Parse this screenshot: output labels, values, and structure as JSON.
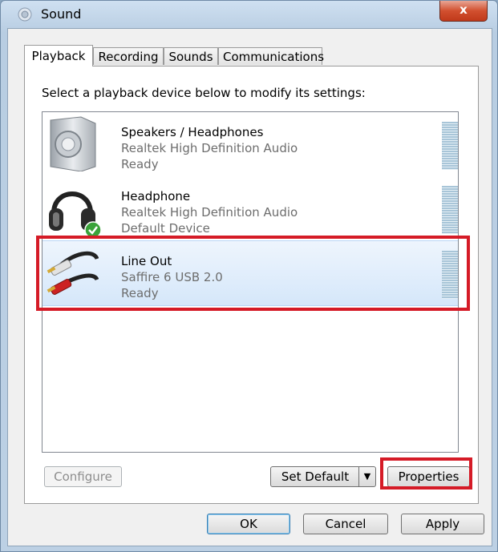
{
  "window": {
    "title": "Sound",
    "close_label": "x"
  },
  "tabs": [
    {
      "label": "Playback",
      "active": true
    },
    {
      "label": "Recording",
      "active": false
    },
    {
      "label": "Sounds",
      "active": false
    },
    {
      "label": "Communications",
      "active": false
    }
  ],
  "instruction": "Select a playback device below to modify its settings:",
  "devices": [
    {
      "name": "Speakers / Headphones",
      "driver": "Realtek High Definition Audio",
      "status": "Ready",
      "icon": "speaker-icon",
      "selected": false
    },
    {
      "name": "Headphone",
      "driver": "Realtek High Definition Audio",
      "status": "Default Device",
      "icon": "headphone-icon",
      "selected": false,
      "default": true
    },
    {
      "name": "Line Out",
      "driver": "Saffire 6 USB 2.0",
      "status": "Ready",
      "icon": "rca-cable-icon",
      "selected": true
    }
  ],
  "buttons": {
    "configure": "Configure",
    "set_default": "Set Default",
    "properties": "Properties",
    "ok": "OK",
    "cancel": "Cancel",
    "apply": "Apply"
  },
  "colors": {
    "highlight": "#d51b27",
    "selection": "#d5e7fa",
    "default_check": "#3aa33a"
  }
}
